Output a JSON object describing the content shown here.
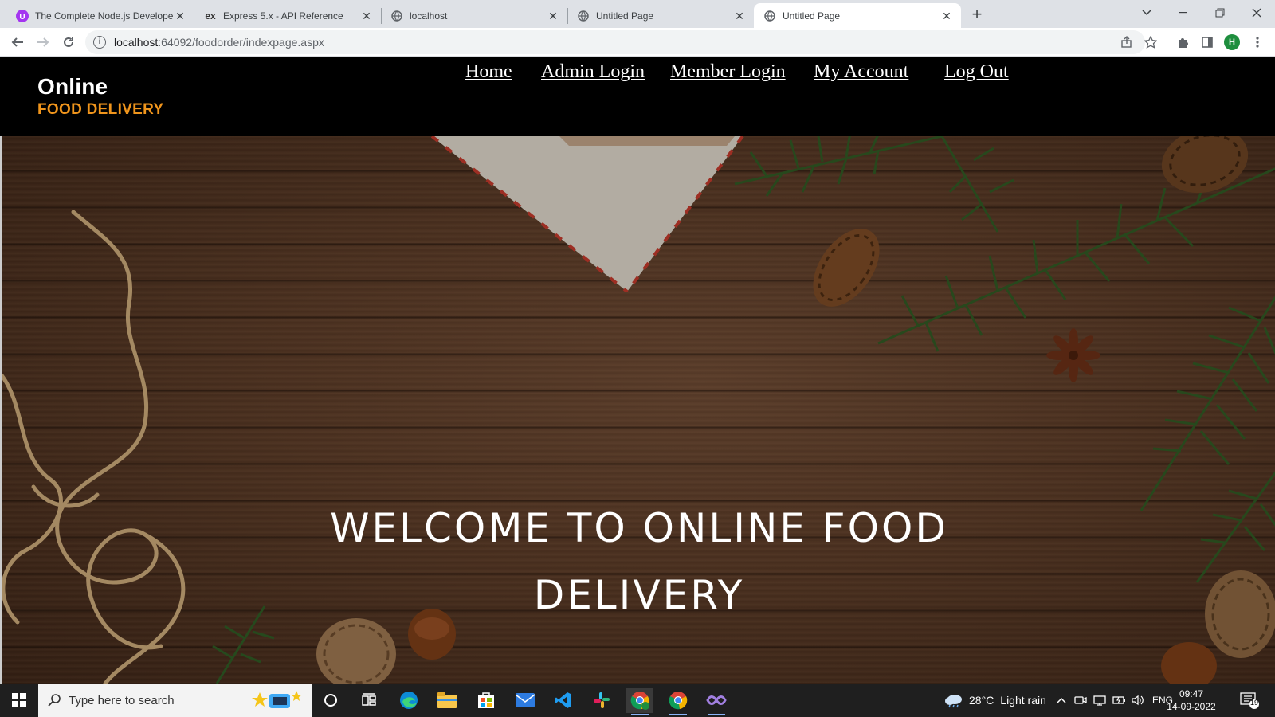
{
  "browser": {
    "tabs": [
      {
        "title": "The Complete Node.js Developer",
        "favicon": "udemy-icon",
        "active": false
      },
      {
        "title": "Express 5.x - API Reference",
        "favicon": "express-icon",
        "active": false
      },
      {
        "title": "localhost",
        "favicon": "globe-icon",
        "active": false
      },
      {
        "title": "Untitled Page",
        "favicon": "globe-icon",
        "active": false
      },
      {
        "title": "Untitled Page",
        "favicon": "globe-icon",
        "active": true
      }
    ],
    "new_tab_label": "+",
    "url_host": "localhost",
    "url_path": ":64092/foodorder/indexpage.aspx",
    "profile_initial": "H"
  },
  "site": {
    "logo_top": "Online",
    "logo_bottom": "FOOD DELIVERY",
    "nav": [
      {
        "label": "Home"
      },
      {
        "label": "Admin Login"
      },
      {
        "label": "Member Login"
      },
      {
        "label": "My Account"
      },
      {
        "label": "Log Out"
      }
    ],
    "hero_line1": "WELCOME TO ONLINE FOOD",
    "hero_line2": "DELIVERY"
  },
  "taskbar": {
    "search_placeholder": "Type here to search",
    "weather": "28°C",
    "weather_text": "Light rain",
    "language": "ENG",
    "time": "09:47",
    "date": "14-09-2022",
    "notification_count": "19"
  },
  "colors": {
    "logo_accent": "#f0951c",
    "header_bg": "#000000",
    "taskbar_bg": "#1f1f1f"
  }
}
